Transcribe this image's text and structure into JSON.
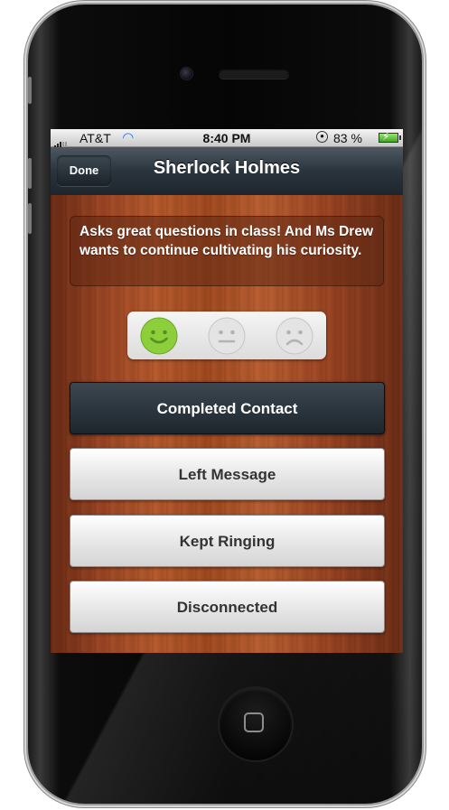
{
  "status_bar": {
    "carrier": "AT&T",
    "time": "8:40 PM",
    "battery_percent": "83 %"
  },
  "nav": {
    "done_label": "Done",
    "title": "Sherlock Holmes"
  },
  "note": {
    "text": "Asks great questions in class! And Ms Drew wants to continue cultivating his curiosity."
  },
  "rating": {
    "selected": "happy",
    "options": [
      "happy",
      "neutral",
      "sad"
    ]
  },
  "actions": [
    {
      "label": "Completed Contact",
      "selected": true
    },
    {
      "label": "Left Message",
      "selected": false
    },
    {
      "label": "Kept Ringing",
      "selected": false
    },
    {
      "label": "Disconnected",
      "selected": false
    }
  ],
  "colors": {
    "happy_face": "#8ccf3a",
    "nav_bar": "#2a343d",
    "wood": "#a1491f"
  }
}
